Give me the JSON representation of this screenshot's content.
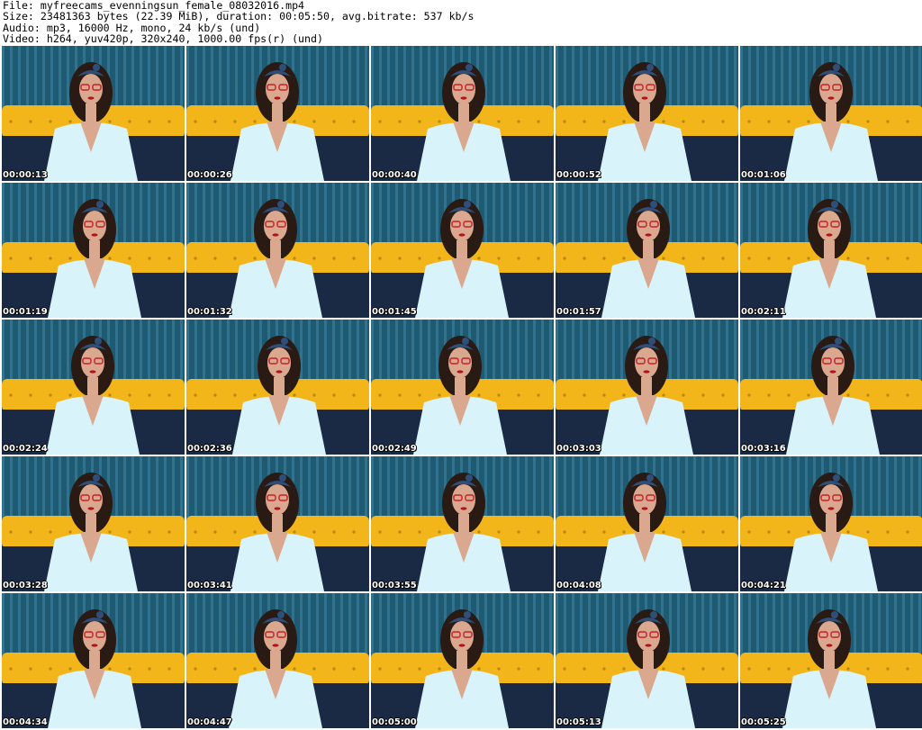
{
  "header": {
    "file_line": "File: myfreecams_evenningsun_female_08032016.mp4",
    "size_line": "Size: 23481363 bytes (22.39 MiB), duration: 00:05:50, avg.bitrate: 537 kb/s",
    "audio_line": "Audio: mp3, 16000 Hz, mono, 24 kb/s (und)",
    "video_line": "Video: h264, yuv420p, 320x240, 1000.00 fps(r) (und)"
  },
  "frames": [
    {
      "time": "00:00:13"
    },
    {
      "time": "00:00:26"
    },
    {
      "time": "00:00:40"
    },
    {
      "time": "00:00:52"
    },
    {
      "time": "00:01:06"
    },
    {
      "time": "00:01:19"
    },
    {
      "time": "00:01:32"
    },
    {
      "time": "00:01:45"
    },
    {
      "time": "00:01:57"
    },
    {
      "time": "00:02:11"
    },
    {
      "time": "00:02:24"
    },
    {
      "time": "00:02:36"
    },
    {
      "time": "00:02:49"
    },
    {
      "time": "00:03:03"
    },
    {
      "time": "00:03:16"
    },
    {
      "time": "00:03:28"
    },
    {
      "time": "00:03:41"
    },
    {
      "time": "00:03:55"
    },
    {
      "time": "00:04:08"
    },
    {
      "time": "00:04:21"
    },
    {
      "time": "00:04:34"
    },
    {
      "time": "00:04:47"
    },
    {
      "time": "00:05:00"
    },
    {
      "time": "00:05:13"
    },
    {
      "time": "00:05:25"
    }
  ],
  "colors": {
    "curtain": "#1f5a73",
    "curtain_stripe": "#3f86a4",
    "headboard": "#f2b51a",
    "bedding": "#1b2a44",
    "shirt": "#d9f3fb",
    "skin": "#d9a88f",
    "hair": "#2a1a14",
    "glasses": "#c7202a",
    "headband": "#2d4f7a"
  }
}
